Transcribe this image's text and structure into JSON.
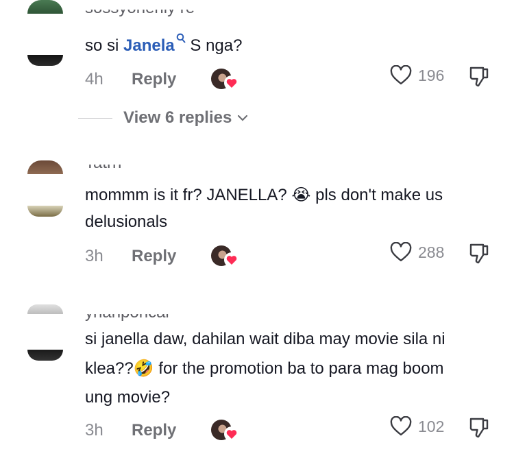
{
  "comments": [
    {
      "username_fragment": "sossyoheniy re",
      "mention": "Janela",
      "text_after_mention": " S nga?",
      "time": "4h",
      "reply_label": "Reply",
      "likes": "196"
    },
    {
      "username_fragment": "Tatrn",
      "text_line1_before": "mommm is it fr? JANELLA? ",
      "emoji": "😭",
      "text_line1_after": " pls don't make us",
      "text_line2": "delusionals",
      "time": "3h",
      "reply_label": "Reply",
      "likes": "288"
    },
    {
      "username_fragment": "yhanponcal",
      "text_line1": "si janella daw, dahilan wait diba may movie sila ni",
      "text_line2_before": "klea??",
      "emoji": "🤣",
      "text_line2_after": " for the promotion ba to para mag boom",
      "text_line3": "ung movie?",
      "time": "3h",
      "reply_label": "Reply",
      "likes": "102"
    }
  ],
  "view_replies": "View 6 replies",
  "colors": {
    "mention": "#2b5db7",
    "like_badge": "#fe2c55",
    "secondary_text": "#8a8b91"
  },
  "icons": [
    "heart-outline-icon",
    "dislike-icon",
    "chevron-down-icon",
    "creator-liked-badge-icon",
    "search-icon"
  ]
}
